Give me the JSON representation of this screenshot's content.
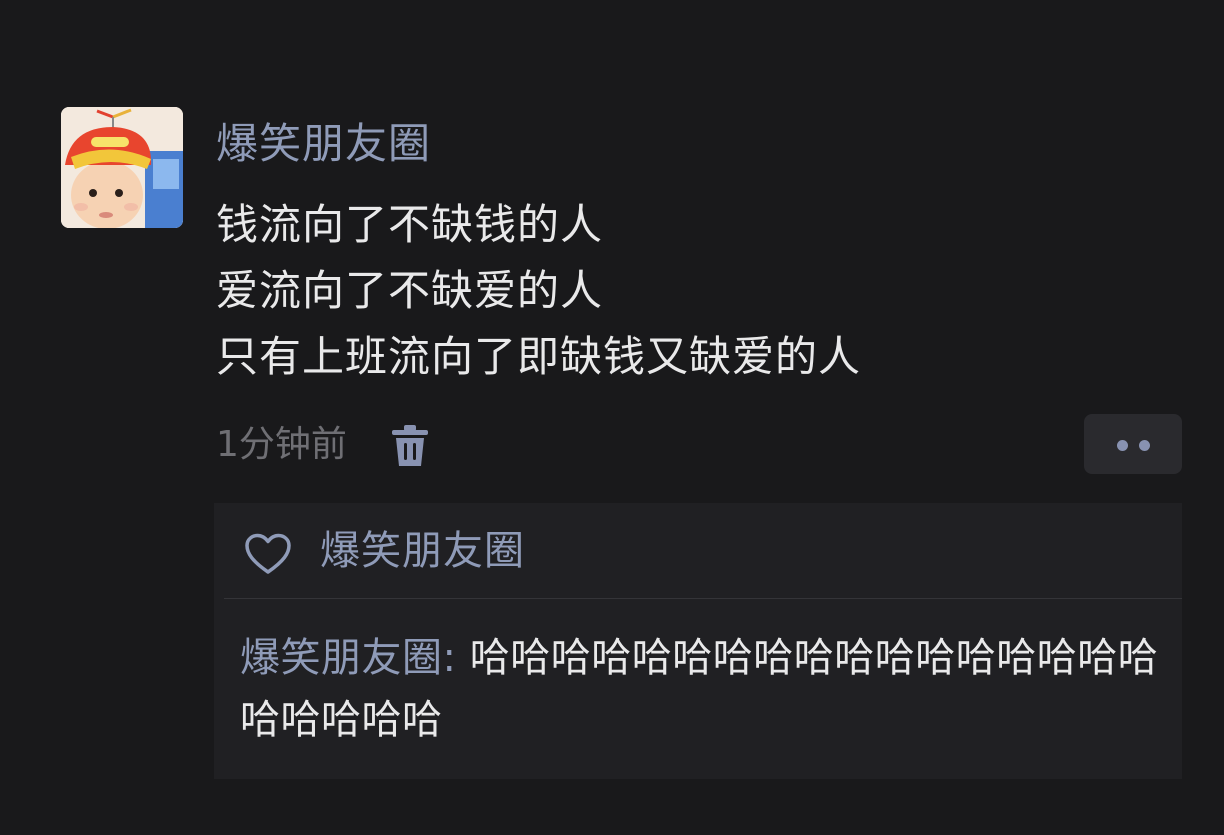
{
  "post": {
    "author": "爆笑朋友圈",
    "lines": [
      "钱流向了不缺钱的人",
      "爱流向了不缺爱的人",
      "只有上班流向了即缺钱又缺爱的人"
    ],
    "timestamp": "1分钟前",
    "icons": {
      "delete": "trash-icon",
      "more": "more-dots-icon"
    }
  },
  "interactions": {
    "like_icon": "heart-icon",
    "likes_text": "爆笑朋友圈",
    "comment": {
      "author": "爆笑朋友圈",
      "separator": ": ",
      "text": "哈哈哈哈哈哈哈哈哈哈哈哈哈哈哈哈哈哈哈哈哈哈"
    }
  },
  "colors": {
    "background": "#19191b",
    "name_blue": "#8f9bb8",
    "text": "#e9e9ea",
    "muted": "#6f6f74",
    "panel": "#202023"
  }
}
